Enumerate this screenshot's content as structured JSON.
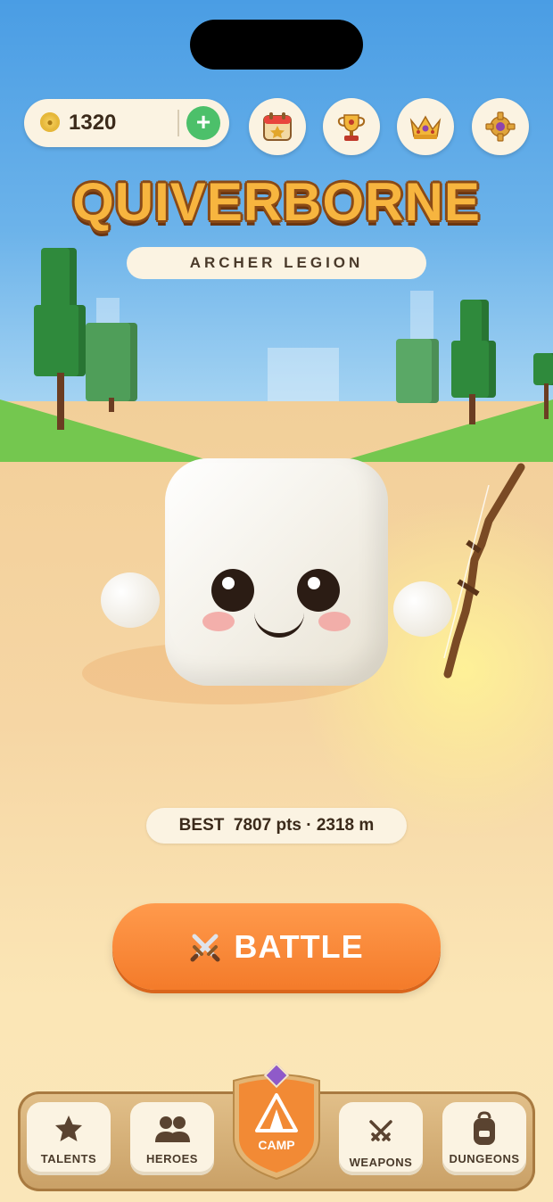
{
  "currency": {
    "coins": "1320",
    "add_symbol": "+"
  },
  "top_buttons": [
    "calendar-icon",
    "trophy-icon",
    "crown-icon",
    "settings-icon"
  ],
  "title": "QUIVERBORNE",
  "subtitle": "ARCHER LEGION",
  "best": {
    "label": "BEST",
    "points": "7807 pts",
    "separator": "·",
    "distance": "2318 m"
  },
  "battle_label": "BATTLE",
  "nav": {
    "talents": "TALENTS",
    "heroes": "HEROES",
    "camp": "CAMP",
    "weapons": "WEAPONS",
    "dungeons": "DUNGEONS"
  },
  "colors": {
    "sky": "#4a9de4",
    "accent_orange": "#f47b2a",
    "title_gold": "#f7b53f",
    "grass": "#74c74f",
    "add_green": "#4cc06a"
  }
}
